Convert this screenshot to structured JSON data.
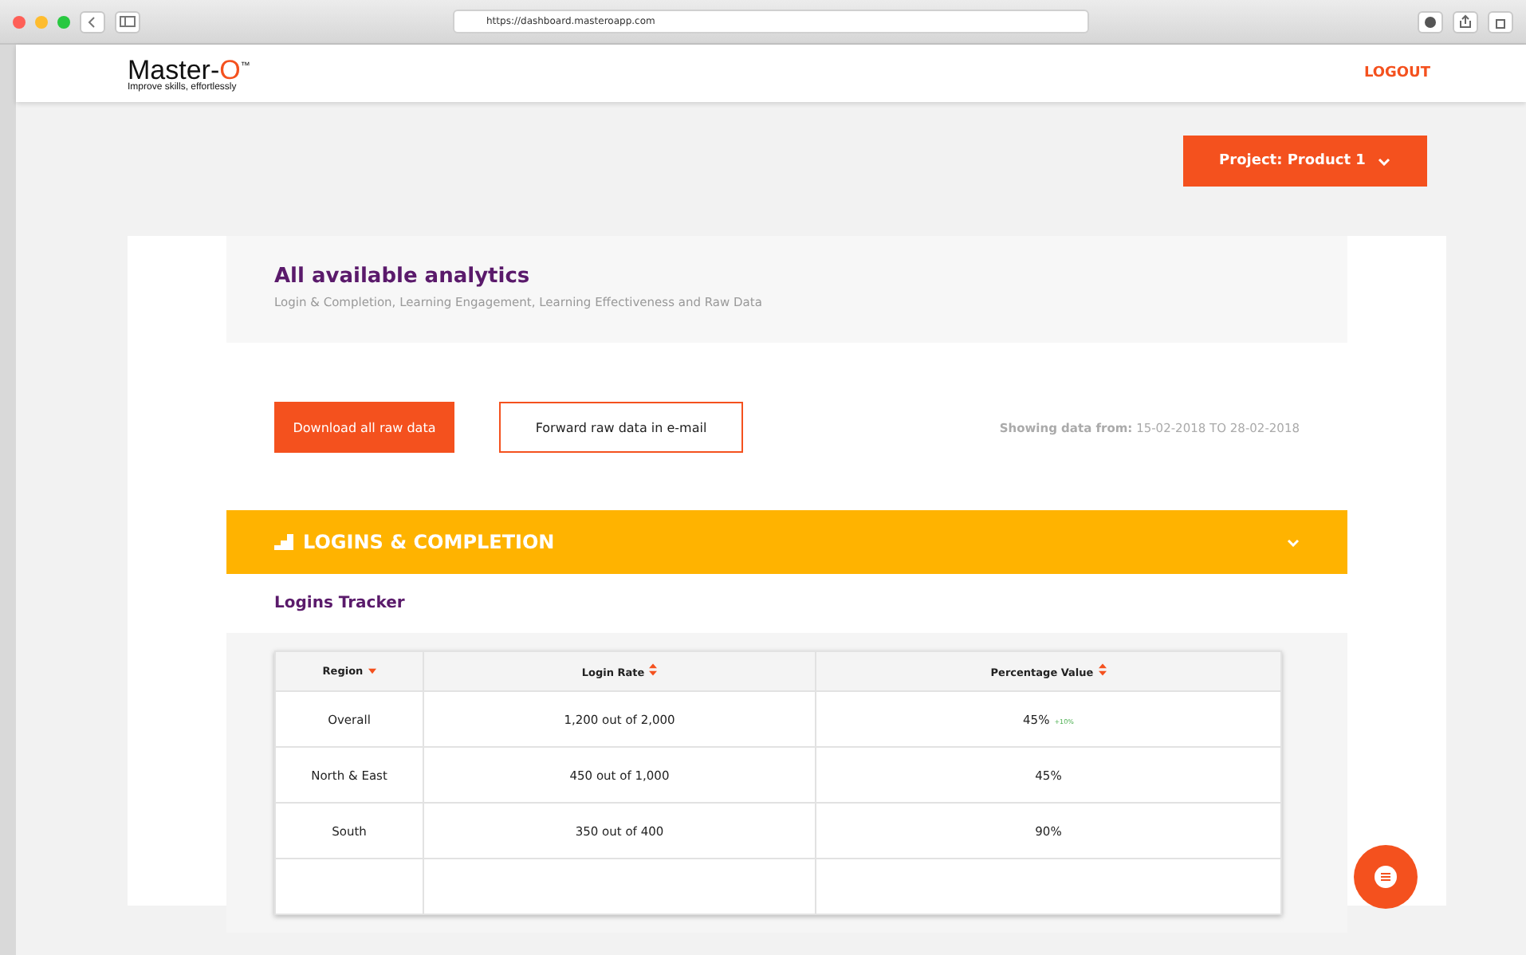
{
  "browser": {
    "url": "https://dashboard.masteroapp.com"
  },
  "header": {
    "logo": "Master-",
    "logo_accent": "O",
    "logo_mark": "™",
    "tagline": "Improve skills, effortlessly",
    "logout": "LOGOUT"
  },
  "project": {
    "label": "Project: Product 1"
  },
  "intro": {
    "title": "All available analytics",
    "subtitle": "Login & Completion, Learning Engagement, Learning Effectiveness and Raw Data"
  },
  "actions": {
    "download": "Download all raw data",
    "forward": "Forward raw data in e-mail",
    "range_label": "Showing data from:",
    "range": "15-02-2018 TO 28-02-2018"
  },
  "section": {
    "title": "LOGINS & COMPLETION",
    "expanded": false
  },
  "tracker": {
    "title": "Logins Tracker",
    "columns": [
      {
        "label": "Region",
        "sorted": true
      },
      {
        "label": "Login Rate",
        "sorted": false
      },
      {
        "label": "Percentage Value",
        "sorted": false
      }
    ],
    "rows": [
      {
        "kind": "data",
        "region": "Overall",
        "rate": "1,200 out of 2,000",
        "value": "45%",
        "trend": "+10%"
      },
      {
        "kind": "data",
        "region": "North & East",
        "rate": "450 out of 1,000",
        "value": "45%"
      },
      {
        "kind": "data",
        "region": "South",
        "rate": "350 out of 400",
        "value": "90%"
      },
      {
        "kind": "blank"
      }
    ]
  }
}
